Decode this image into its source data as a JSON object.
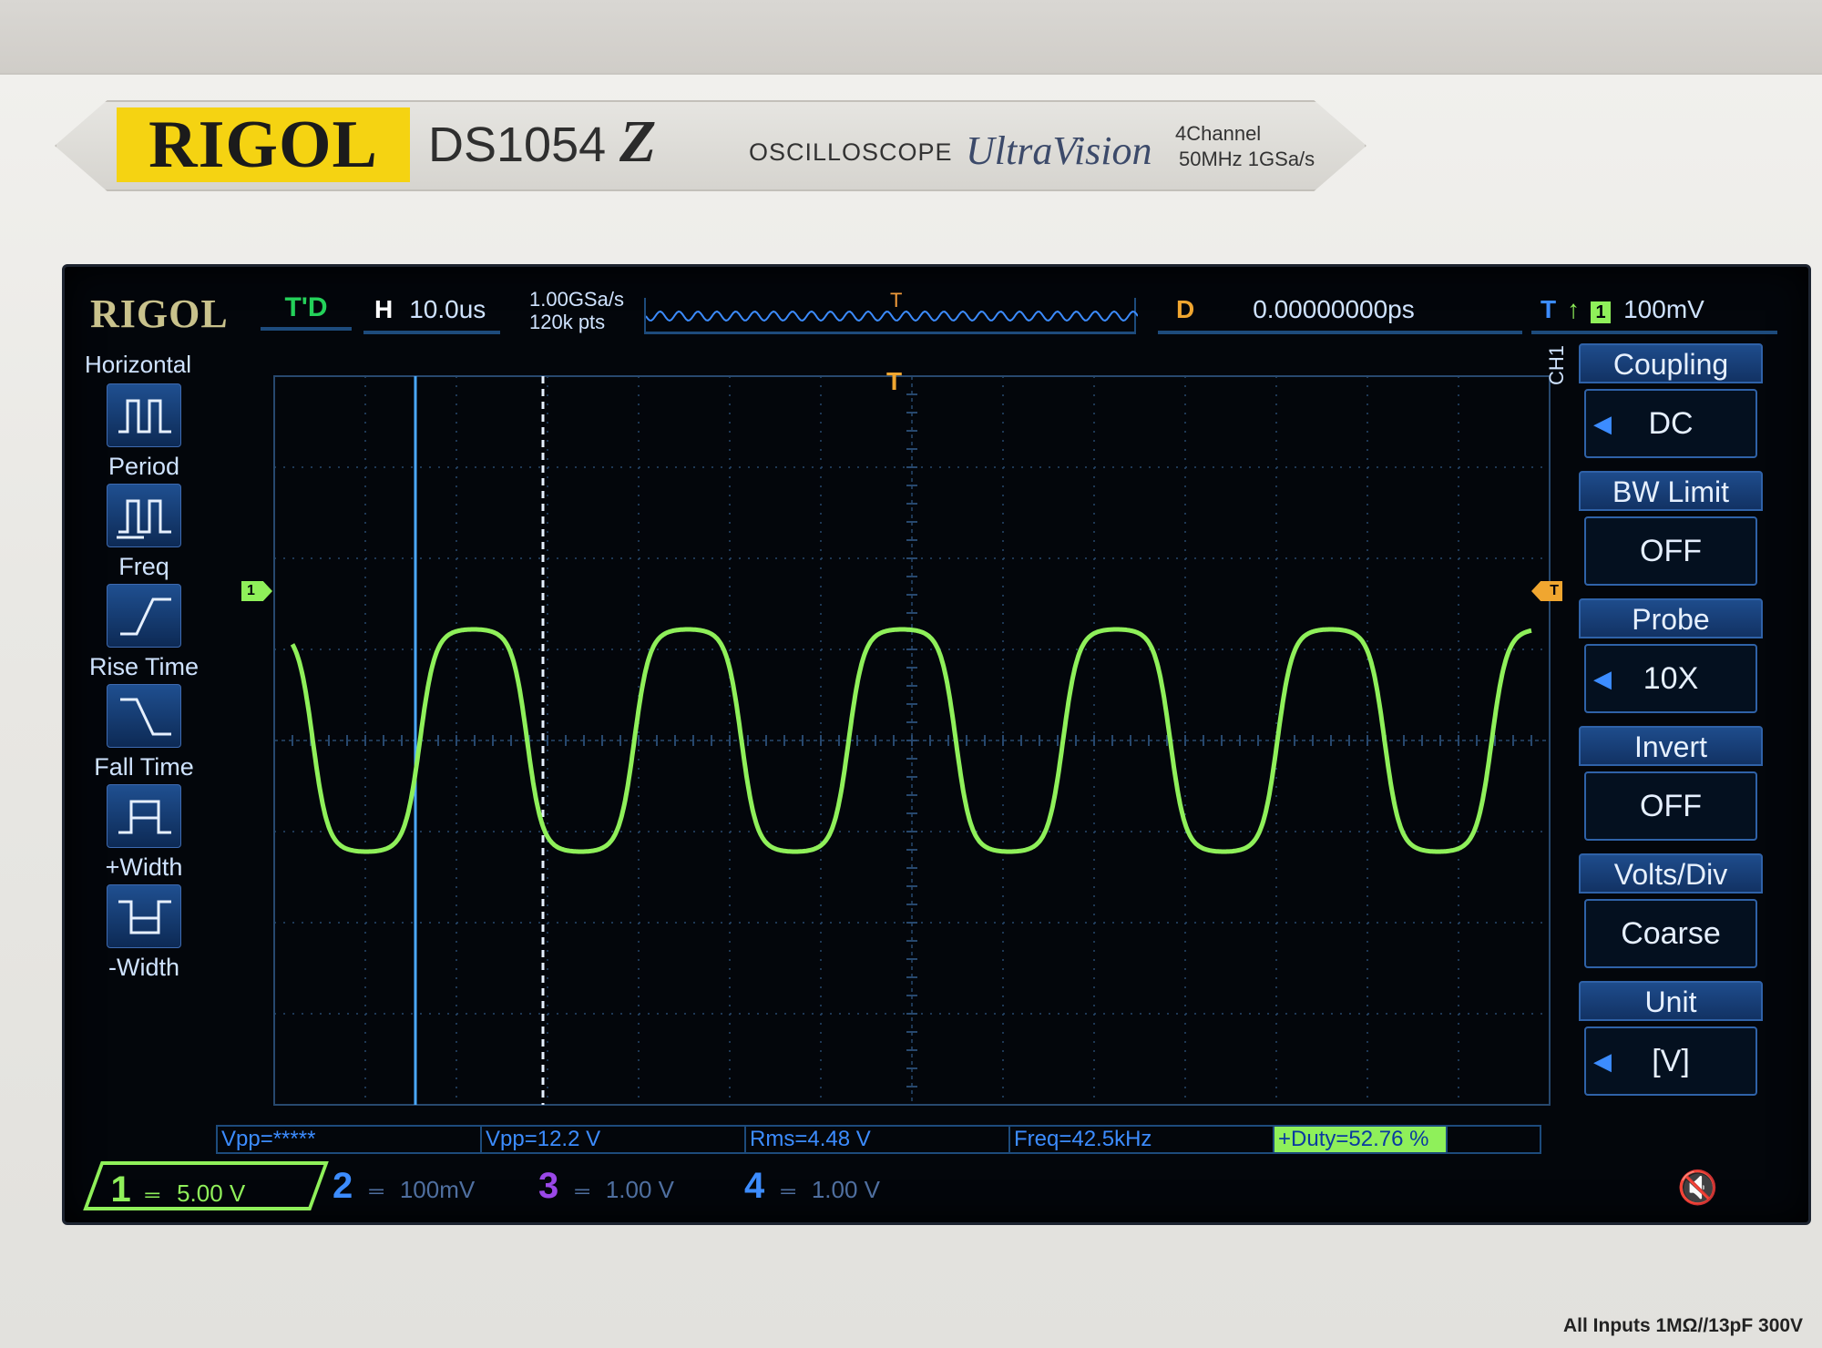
{
  "device": {
    "brand": "RIGOL",
    "model": "DS1054",
    "model_suffix": "Z",
    "type": "OSCILLOSCOPE",
    "series": "UltraVision",
    "channels_spec": "4Channel",
    "bw_spec": "50MHz  1GSa/s",
    "inputs_spec": "All Inputs 1MΩ//13pF 300V"
  },
  "status_bar": {
    "logo": "RIGOL",
    "run_state": "T'D",
    "horizontal_label": "H",
    "timebase": "10.0us",
    "sample_rate": "1.00GSa/s",
    "memory_depth": "120k pts",
    "delay_label": "D",
    "delay_value": "0.00000000ps",
    "trigger_label": "T",
    "trigger_edge": "↑",
    "trigger_source": "1",
    "trigger_level": "100mV"
  },
  "left_menu": {
    "title": "Horizontal",
    "items": [
      {
        "label": "Period",
        "icon": "period-icon"
      },
      {
        "label": "Freq",
        "icon": "freq-icon"
      },
      {
        "label": "Rise Time",
        "icon": "rise-time-icon"
      },
      {
        "label": "Fall Time",
        "icon": "fall-time-icon"
      },
      {
        "label": "+Width",
        "icon": "positive-width-icon"
      },
      {
        "label": "-Width",
        "icon": "negative-width-icon"
      }
    ]
  },
  "right_menu": {
    "channel_tag": "CH1",
    "items": [
      {
        "title": "Coupling",
        "value": "DC",
        "has_arrow": true
      },
      {
        "title": "BW Limit",
        "value": "OFF",
        "has_arrow": false
      },
      {
        "title": "Probe",
        "value": "10X",
        "has_arrow": true
      },
      {
        "title": "Invert",
        "value": "OFF",
        "has_arrow": false
      },
      {
        "title": "Volts/Div",
        "value": "Coarse",
        "has_arrow": false
      },
      {
        "title": "Unit",
        "value": "[V]",
        "has_arrow": true
      }
    ]
  },
  "markers": {
    "ch1": "1",
    "trigger_level": "T",
    "trigger_position": "T"
  },
  "measurements": [
    {
      "label": "Vpp=*****"
    },
    {
      "label": "Vpp=12.2 V"
    },
    {
      "label": "Rms=4.48 V"
    },
    {
      "label": "Freq=42.5kHz"
    },
    {
      "label": "+Duty=52.76 %"
    }
  ],
  "channels": [
    {
      "num": "1",
      "coupling": "═",
      "scale": "5.00 V",
      "active": true
    },
    {
      "num": "2",
      "coupling": "═",
      "scale": "100mV",
      "active": false
    },
    {
      "num": "3",
      "coupling": "═",
      "scale": "1.00 V",
      "active": false
    },
    {
      "num": "4",
      "coupling": "═",
      "scale": "1.00 V",
      "active": false
    }
  ],
  "colors": {
    "ch1": "#8ff05a",
    "ch2": "#3c8cff",
    "ch3": "#9b48e8",
    "ch4": "#3c8cff",
    "trigger": "#f0a630",
    "grid": "#27486e"
  },
  "chart_data": {
    "type": "line",
    "trace": "ch1",
    "x_unit": "us",
    "y_unit": "div",
    "xlim": [
      -70,
      70
    ],
    "ylim": [
      -4,
      4
    ],
    "frequency_khz": 42.5,
    "amplitude_div": 1.22,
    "offset_div": 0.0,
    "cursors_x": [
      -54.5,
      -40.5
    ]
  }
}
